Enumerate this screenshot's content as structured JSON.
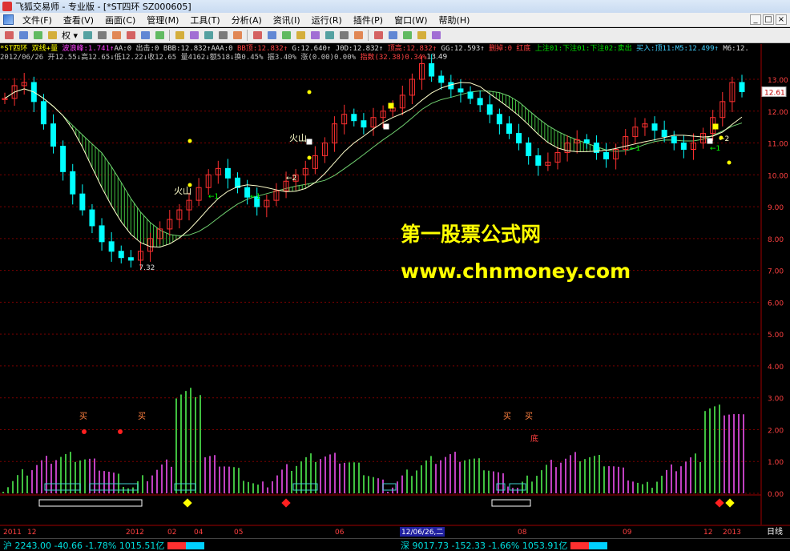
{
  "window": {
    "title": "飞狐交易师 - 专业版 - [*ST四环  SZ000605]",
    "controls": [
      "_",
      "□",
      "×"
    ]
  },
  "menu": [
    "文件(F)",
    "查看(V)",
    "画面(C)",
    "管理(M)",
    "工具(T)",
    "分析(A)",
    "资讯(I)",
    "运行(R)",
    "插件(P)",
    "窗口(W)",
    "帮助(H)"
  ],
  "toolbar": {
    "rights_label": "权",
    "icons": [
      "back-icon",
      "grid-icon",
      "plus-icon",
      "cross-icon",
      "rights-icon",
      "chart-icon",
      "stack-icon",
      "book-icon",
      "memo-icon",
      "bell-icon",
      "alarm-icon",
      "hammer-icon",
      "table-icon",
      "columns-icon",
      "panel-icon",
      "window-icon",
      "cursor-icon",
      "pencil-icon",
      "line-icon",
      "bars-icon",
      "fib-icon",
      "channel-icon",
      "rect-icon",
      "ellipse-icon",
      "text-icon",
      "eraser-icon",
      "lock-icon",
      "color-icon",
      "save-icon"
    ]
  },
  "info": {
    "line1": [
      {
        "t": "*ST四环  双线+量",
        "c": "y"
      },
      {
        "t": "  波浪峰:1.741↑",
        "c": "m"
      },
      {
        "t": "AA:0",
        "c": "w"
      },
      {
        "t": " 出击:0",
        "c": "w"
      },
      {
        "t": " BBB:12.832↑",
        "c": "w"
      },
      {
        "t": "AAA:0",
        "c": "w"
      },
      {
        "t": " BB顶:12.832↑",
        "c": "r"
      },
      {
        "t": " G:12.640↑",
        "c": "w"
      },
      {
        "t": " J0D:12.832↑",
        "c": "w"
      },
      {
        "t": " 顶高:12.832↑",
        "c": "r"
      },
      {
        "t": " GG:12.593↑",
        "c": "w"
      },
      {
        "t": " 删掉:0",
        "c": "r"
      },
      {
        "t": " 红底",
        "c": "r"
      },
      {
        "t": " 上注01:下注01:下注02:卖出",
        "c": "g"
      },
      {
        "t": " 买入:顶11:M5:12.499↑",
        "c": "c"
      },
      {
        "t": " M6:12.",
        "c": "w"
      }
    ],
    "line2": "2012/06/26 开12.55↓高12.65↓低12.22↓收12.65 量4162↓额518↓换0.45% 振3.40% 涨(0.00)0.00%",
    "line2_tail": "指数(32.38)0.34%"
  },
  "chart": {
    "price_axis": [
      "13.00",
      "12.00",
      "11.00",
      "10.00",
      "9.00",
      "8.00",
      "7.00",
      "6.00",
      "5.00",
      "4.00",
      "3.00",
      "2.00",
      "1.00",
      "0.00"
    ],
    "current_price_tag": "12.61",
    "high_label": "13.49",
    "low_label": "7.32",
    "annotations": {
      "volcano": "火山",
      "buy": "买",
      "bottom": "底",
      "arrow_one": "←1",
      "arrow_two": "←2"
    },
    "watermark_line1": "第一股票公式网",
    "watermark_line2": "www.chnmoney.com",
    "date_axis": [
      "2011",
      "12",
      "2012",
      "02",
      "04",
      "05",
      "06",
      "08",
      "09",
      "12",
      "2013"
    ],
    "cursor_date": "12/06/26,二",
    "period": "日线"
  },
  "chart_data": {
    "type": "line",
    "title": "",
    "xlabel": "",
    "ylabel": "",
    "ylim": [
      0,
      13.5
    ],
    "series": [
      {
        "name": "",
        "values": [
          12.4,
          12.8,
          12.9,
          12.3,
          11.6,
          10.9,
          10.1,
          9.4,
          8.9,
          8.4,
          7.9,
          7.6,
          7.4,
          7.32,
          7.6,
          8.0,
          8.3,
          8.6,
          8.9,
          9.2,
          9.6,
          10.0,
          10.2,
          9.9,
          9.6,
          9.3,
          9.0,
          9.2,
          9.5,
          9.8,
          10.0,
          10.2,
          10.6,
          11.0,
          11.6,
          11.9,
          11.7,
          11.5,
          11.8,
          12.0,
          12.1,
          12.5,
          13.0,
          13.49,
          13.1,
          12.9,
          12.7,
          12.6,
          12.4,
          12.2,
          11.9,
          11.6,
          11.3,
          11.0,
          10.6,
          10.3,
          10.4,
          10.7,
          11.0,
          11.1,
          11.0,
          10.7,
          10.5,
          10.8,
          11.2,
          11.5,
          11.6,
          11.4,
          11.2,
          11.0,
          10.8,
          11.0,
          11.3,
          11.8,
          12.3,
          12.9,
          12.61
        ]
      }
    ]
  },
  "status": {
    "sh": "沪 2243.00 -40.66 -1.78% 1015.51亿",
    "sz": "深 9017.73 -152.33 -1.66% 1053.91亿"
  },
  "colors": {
    "up": "#ff3030",
    "down": "#00ffff",
    "ma": "#ffffcc",
    "band": "#40c040",
    "vol_up": "#c040c0",
    "vol_down": "#40c040",
    "grid": "#7a0000",
    "watermark": "#ffff00"
  }
}
